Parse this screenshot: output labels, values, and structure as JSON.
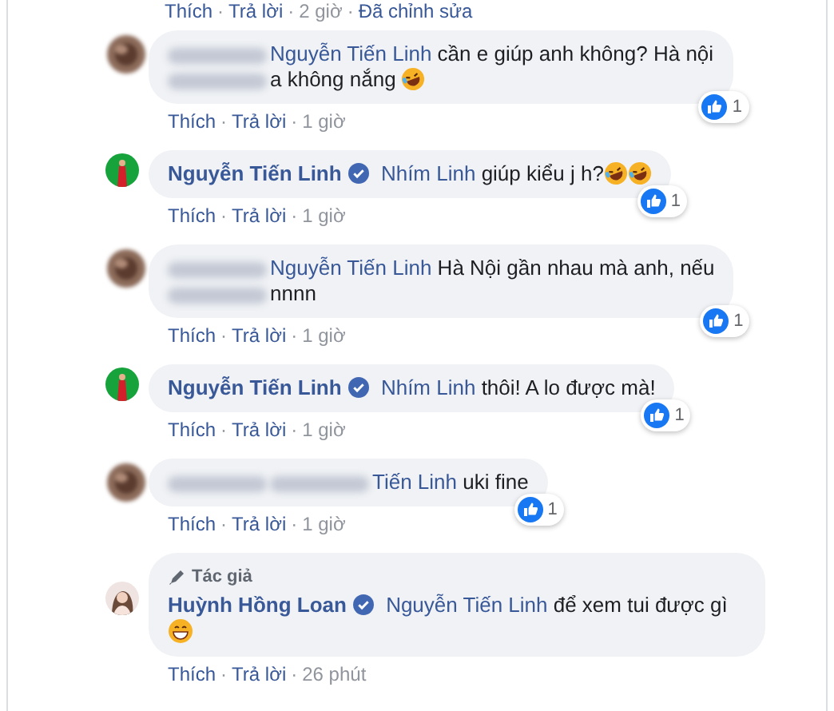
{
  "separator": "·",
  "top_actions": [
    {
      "label": "Thích",
      "kind": "link"
    },
    {
      "label": "Trả lời",
      "kind": "link"
    },
    {
      "label": "2 giờ",
      "kind": "time"
    },
    {
      "label": "Đã chỉnh sửa",
      "kind": "link"
    }
  ],
  "comments": [
    {
      "avatar": {
        "kind": "blurred"
      },
      "author_blurred": true,
      "verified": false,
      "lines": [
        [
          {
            "kind": "mention",
            "text": "Nguyễn Tiến Linh"
          },
          {
            "kind": "text",
            "text": " cần e giúp anh không? Hà nội"
          }
        ],
        [
          {
            "kind": "blur"
          },
          {
            "kind": "text",
            "text": "a không nắng "
          },
          {
            "kind": "rofl"
          }
        ]
      ],
      "reaction": {
        "count": "1"
      },
      "actions": [
        {
          "label": "Thích",
          "kind": "link"
        },
        {
          "label": "Trả lời",
          "kind": "link"
        },
        {
          "label": "1 giờ",
          "kind": "time"
        }
      ]
    },
    {
      "avatar": {
        "kind": "green"
      },
      "author": "Nguyễn Tiến Linh",
      "verified": true,
      "lines": [
        [
          {
            "kind": "mention",
            "text": "Nhím Linh"
          },
          {
            "kind": "text",
            "text": " giúp kiểu j h?"
          },
          {
            "kind": "rofl"
          },
          {
            "kind": "rofl"
          }
        ]
      ],
      "reaction": {
        "count": "1"
      },
      "actions": [
        {
          "label": "Thích",
          "kind": "link"
        },
        {
          "label": "Trả lời",
          "kind": "link"
        },
        {
          "label": "1 giờ",
          "kind": "time"
        }
      ]
    },
    {
      "avatar": {
        "kind": "blurred"
      },
      "author_blurred": true,
      "verified": false,
      "lines": [
        [
          {
            "kind": "mention",
            "text": "Nguyễn Tiến Linh"
          },
          {
            "kind": "text",
            "text": " Hà Nội gần nhau mà anh, nếu"
          }
        ],
        [
          {
            "kind": "blur"
          },
          {
            "kind": "text",
            "text": "nnnn"
          }
        ]
      ],
      "reaction": {
        "count": "1"
      },
      "actions": [
        {
          "label": "Thích",
          "kind": "link"
        },
        {
          "label": "Trả lời",
          "kind": "link"
        },
        {
          "label": "1 giờ",
          "kind": "time"
        }
      ]
    },
    {
      "avatar": {
        "kind": "green"
      },
      "author": "Nguyễn Tiến Linh",
      "verified": true,
      "lines": [
        [
          {
            "kind": "mention",
            "text": "Nhím Linh"
          },
          {
            "kind": "text",
            "text": " thôi! A lo được mà!"
          }
        ]
      ],
      "reaction": {
        "count": "1"
      },
      "actions": [
        {
          "label": "Thích",
          "kind": "link"
        },
        {
          "label": "Trả lời",
          "kind": "link"
        },
        {
          "label": "1 giờ",
          "kind": "time"
        }
      ]
    },
    {
      "avatar": {
        "kind": "blurred"
      },
      "author_blurred": true,
      "verified": false,
      "lines": [
        [
          {
            "kind": "blur"
          },
          {
            "kind": "mention",
            "text": "Tiến Linh"
          },
          {
            "kind": "text",
            "text": " uki fine"
          }
        ]
      ],
      "reaction": {
        "count": "1"
      },
      "actions": [
        {
          "label": "Thích",
          "kind": "link"
        },
        {
          "label": "Trả lời",
          "kind": "link"
        },
        {
          "label": "1 giờ",
          "kind": "time"
        }
      ]
    },
    {
      "avatar": {
        "kind": "portrait"
      },
      "author_badge": "Tác giả",
      "author": "Huỳnh Hồng Loan",
      "verified": true,
      "lines": [
        [
          {
            "kind": "mention",
            "text": "Nguyễn Tiến Linh"
          },
          {
            "kind": "text",
            "text": " để xem tui được gì"
          }
        ],
        [
          {
            "kind": "grin"
          }
        ]
      ],
      "actions": [
        {
          "label": "Thích",
          "kind": "link"
        },
        {
          "label": "Trả lời",
          "kind": "link"
        },
        {
          "label": "26 phút",
          "kind": "time"
        }
      ]
    }
  ]
}
